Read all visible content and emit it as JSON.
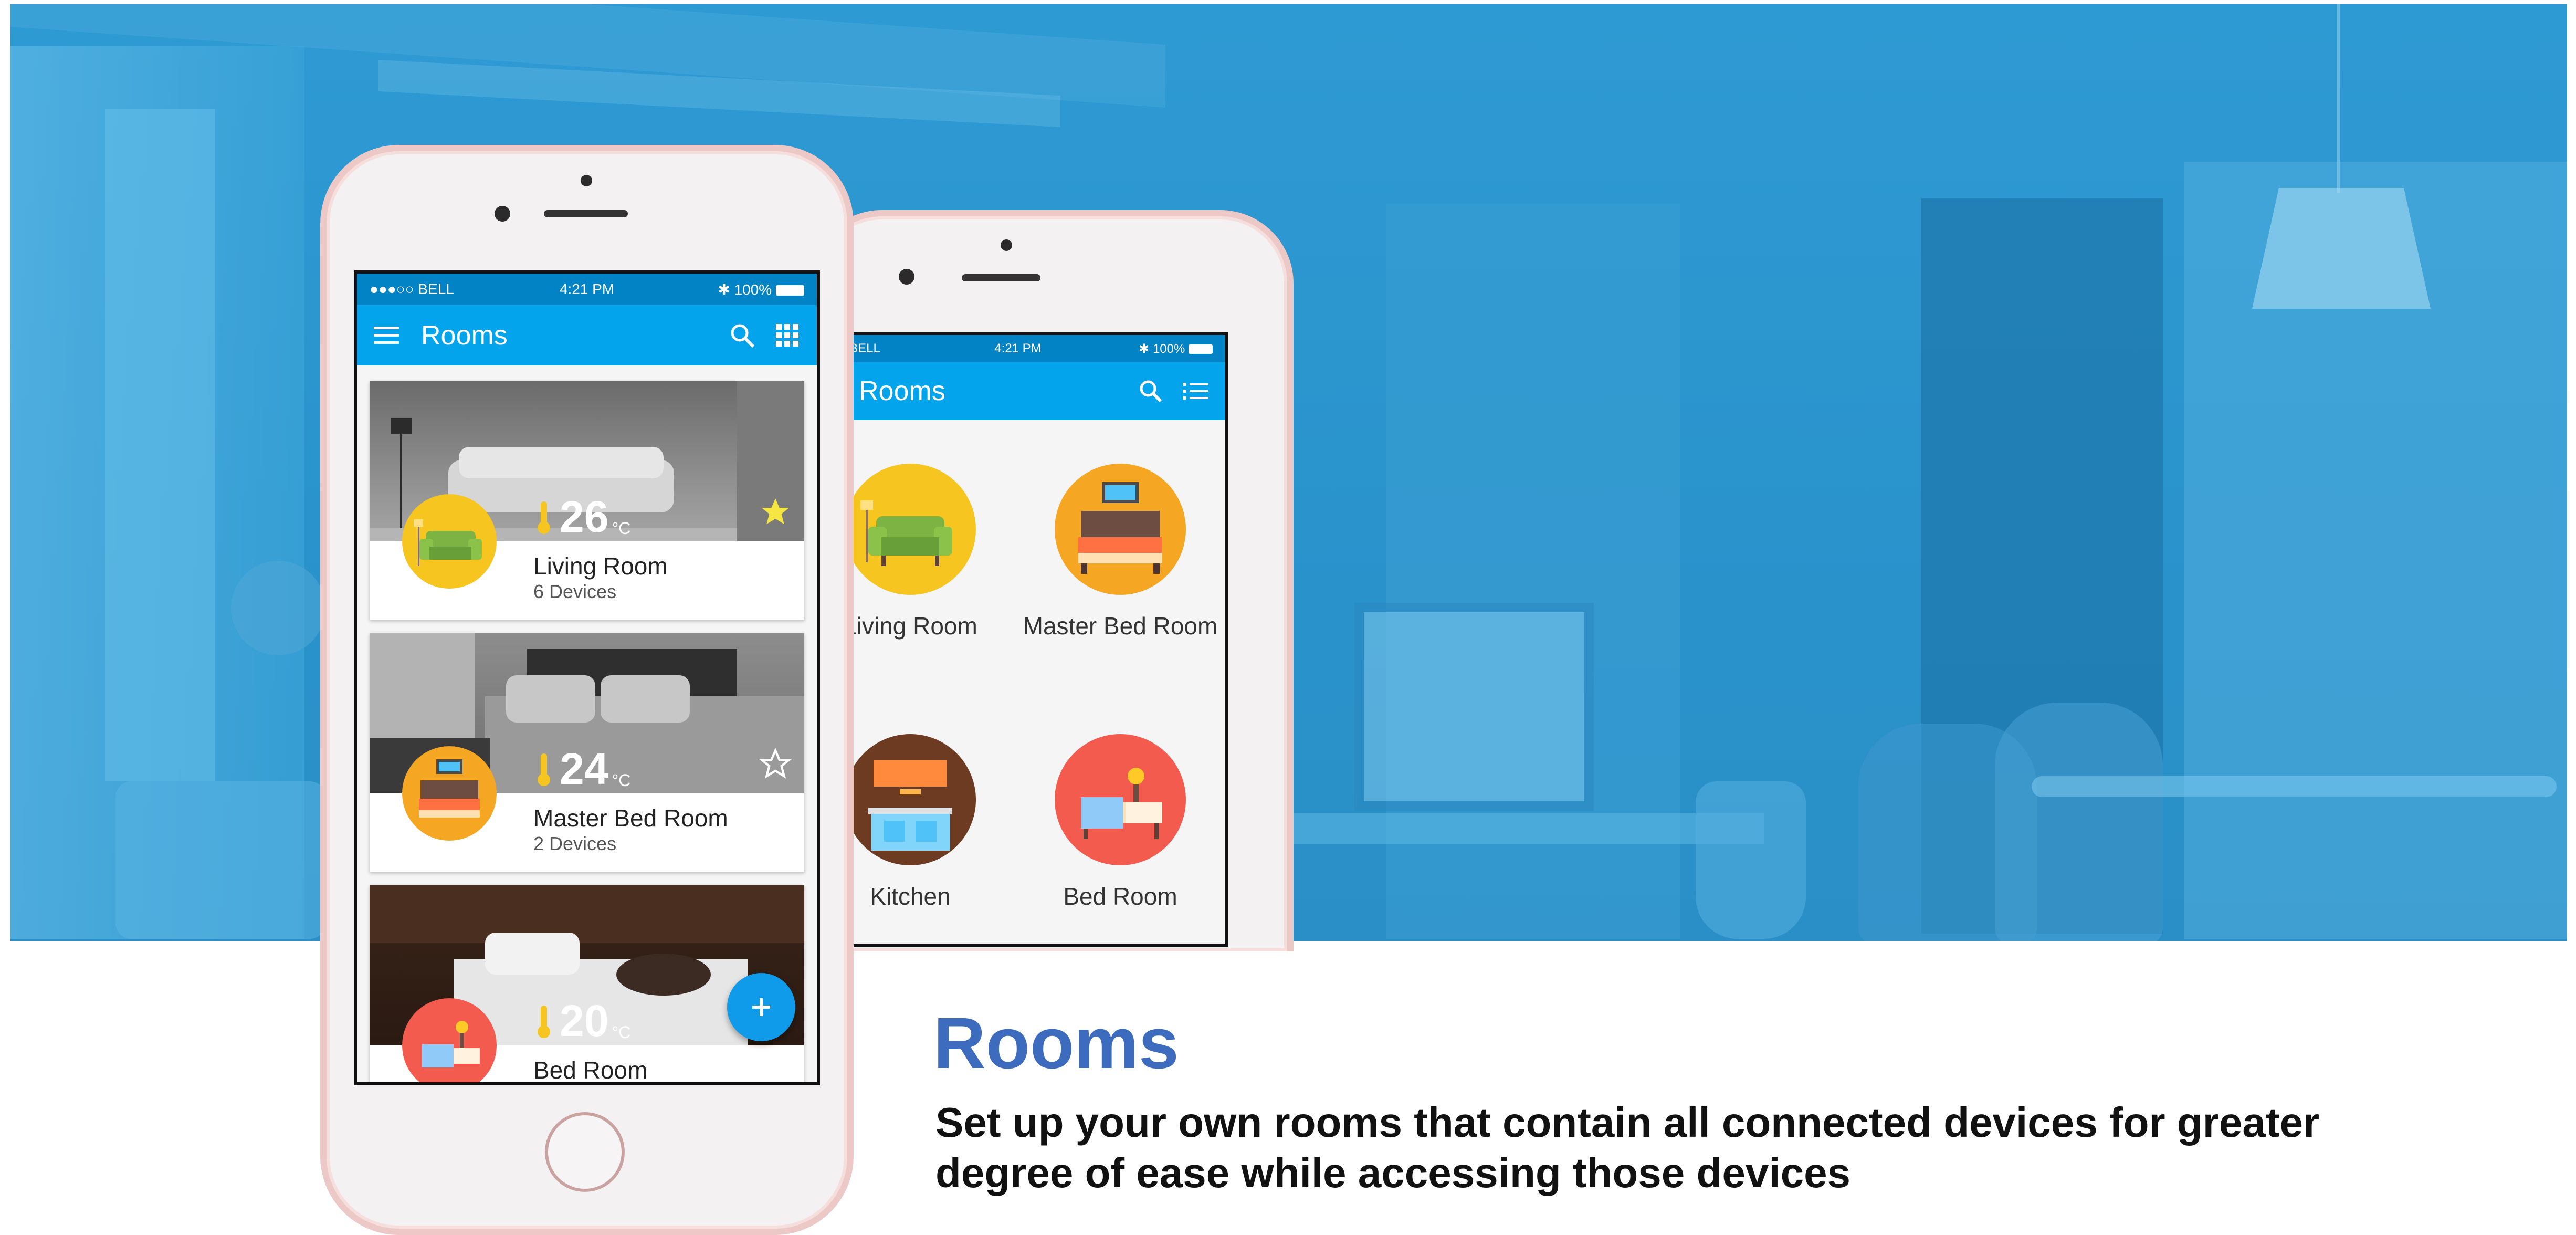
{
  "phone_left": {
    "status": {
      "carrier": "●●●○○ BELL",
      "time": "4:21 PM",
      "battery": "100%"
    },
    "appbar": {
      "title": "Rooms",
      "menu_icon": "menu-icon",
      "search_icon": "search-icon",
      "view_icon": "grid-view-icon"
    },
    "rooms": [
      {
        "name": "Living Room",
        "devices": "6 Devices",
        "temp": "26",
        "unit": "°C",
        "favorite": true
      },
      {
        "name": "Master Bed Room",
        "devices": "2 Devices",
        "temp": "24",
        "unit": "°C",
        "favorite": false
      },
      {
        "name": "Bed Room",
        "devices": "",
        "temp": "20",
        "unit": "°C",
        "favorite": false
      }
    ],
    "fab_icon": "plus-icon"
  },
  "phone_right": {
    "status": {
      "carrier": "●●○ BELL",
      "time": "4:21 PM",
      "battery": "100%"
    },
    "appbar": {
      "title": "Rooms",
      "menu_icon": "menu-icon",
      "search_icon": "search-icon",
      "view_icon": "list-view-icon"
    },
    "rooms": [
      {
        "label": "Living Room"
      },
      {
        "label": "Master Bed Room"
      },
      {
        "label": "Kitchen"
      },
      {
        "label": "Bed Room"
      }
    ]
  },
  "colors": {
    "appbar": "#03a4ec",
    "status": "#0283c6",
    "heading": "#3d6bbd",
    "fab": "#0f9be9",
    "hero": "#2e9ad3"
  },
  "feature": {
    "title": "Rooms",
    "description": "Set up your own rooms that contain all connected devices for greater degree of ease while accessing those devices"
  }
}
